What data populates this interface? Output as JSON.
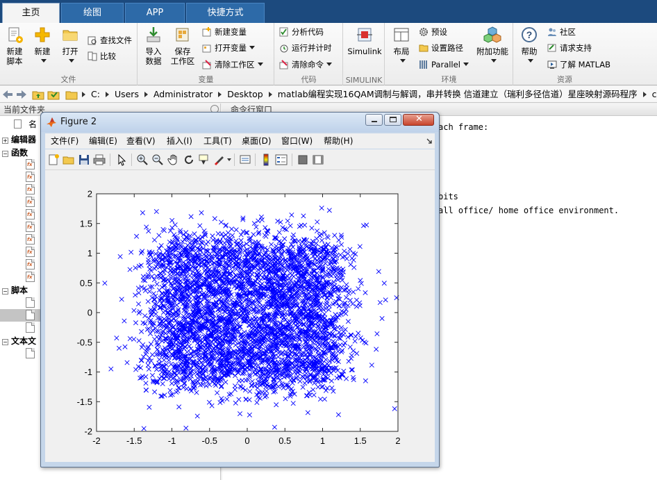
{
  "tabs": [
    {
      "label": "主页",
      "active": true
    },
    {
      "label": "绘图",
      "active": false
    },
    {
      "label": "APP",
      "active": false
    },
    {
      "label": "快捷方式",
      "active": false
    }
  ],
  "ribbon": {
    "file": {
      "label": "文件",
      "new_script": "新建\n脚本",
      "new": "新建",
      "open": "打开",
      "find_files": "查找文件",
      "compare": "比较"
    },
    "variable": {
      "label": "变量",
      "import": "导入\n数据",
      "save_ws": "保存\n工作区",
      "new_var": "新建变量",
      "open_var": "打开变量",
      "clear_ws": "清除工作区"
    },
    "code": {
      "label": "代码",
      "analyze": "分析代码",
      "run_time": "运行并计时",
      "clear_cmd": "清除命令"
    },
    "simulink": {
      "label": "SIMULINK",
      "btn": "Simulink"
    },
    "env": {
      "label": "环境",
      "layout": "布局",
      "prefs": "预设",
      "set_path": "设置路径",
      "parallel": "Parallel",
      "addons": "附加功能"
    },
    "resources": {
      "label": "资源",
      "help": "帮助",
      "community": "社区",
      "support": "请求支持",
      "learn": "了解 MATLAB"
    }
  },
  "address": {
    "crumbs": [
      "C:",
      "Users",
      "Administrator",
      "Desktop",
      "matlab编程实现16QAM调制与解调，串并转换 信道建立（瑞利多径信道）星座映射源码程序",
      "code"
    ]
  },
  "left_panel": {
    "title": "当前文件夹",
    "col_name": "名",
    "sections": {
      "editor": "编辑器",
      "functions": "函数",
      "scripts": "脚本",
      "text_files": "文本文"
    }
  },
  "command_window": {
    "title": "命令行窗口",
    "lines": [
      "ach frame:",
      "bits",
      "all office/ home office environment."
    ]
  },
  "figure": {
    "title": "Figure 2",
    "menu": [
      "文件(F)",
      "编辑(E)",
      "查看(V)",
      "插入(I)",
      "工具(T)",
      "桌面(D)",
      "窗口(W)",
      "帮助(H)"
    ],
    "toolbar_icons": [
      "new-figure-icon",
      "open-file-icon",
      "save-icon",
      "print-icon",
      "pointer-icon",
      "zoom-in-icon",
      "zoom-out-icon",
      "pan-hand-icon",
      "rotate-3d-icon",
      "data-cursor-icon",
      "brush-icon",
      "link-plot-icon",
      "colorbar-icon",
      "legend-icon",
      "hide-plot-tools-icon",
      "show-plot-tools-icon"
    ]
  },
  "chart_data": {
    "type": "scatter",
    "title": "",
    "xlabel": "",
    "ylabel": "",
    "xlim": [
      -2,
      2
    ],
    "ylim": [
      -2,
      2
    ],
    "xticks": [
      "-2",
      "-1.5",
      "-1",
      "-0.5",
      "0",
      "0.5",
      "1",
      "1.5",
      "2"
    ],
    "yticks": [
      "2",
      "1.5",
      "1",
      "0.5",
      "0",
      "-0.5",
      "-1",
      "-1.5",
      "-2"
    ],
    "marker": "x",
    "marker_color": "#0000ff",
    "grid": false,
    "clusters_x": [
      -0.9,
      -0.3,
      0.3,
      0.9
    ],
    "clusters_y": [
      -0.9,
      -0.3,
      0.3,
      0.9
    ],
    "cluster_spread": 0.24,
    "points_per_cluster": 260
  }
}
